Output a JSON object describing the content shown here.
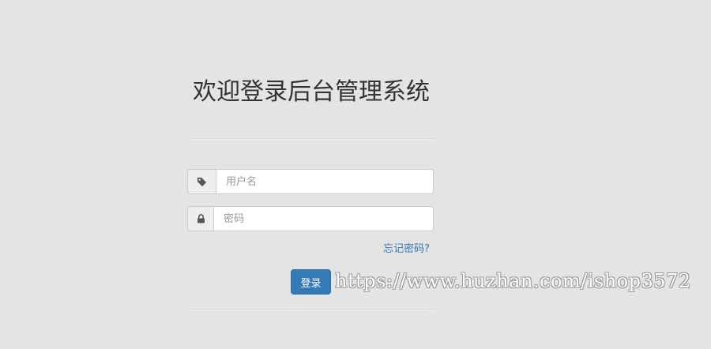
{
  "login": {
    "title": "欢迎登录后台管理系统",
    "username": {
      "placeholder": "用户名",
      "value": "",
      "icon": "tag-icon"
    },
    "password": {
      "placeholder": "密码",
      "value": "",
      "icon": "lock-icon"
    },
    "forgot_label": "忘记密码?",
    "submit_label": "登录"
  },
  "watermark": {
    "text": "https://www.huzhan.com/ishop3572"
  },
  "colors": {
    "background": "#e4e4e4",
    "primary": "#337ab7",
    "link": "#337ab7",
    "title": "#333333",
    "addon": "#eeeeee",
    "border": "#cccccc"
  }
}
